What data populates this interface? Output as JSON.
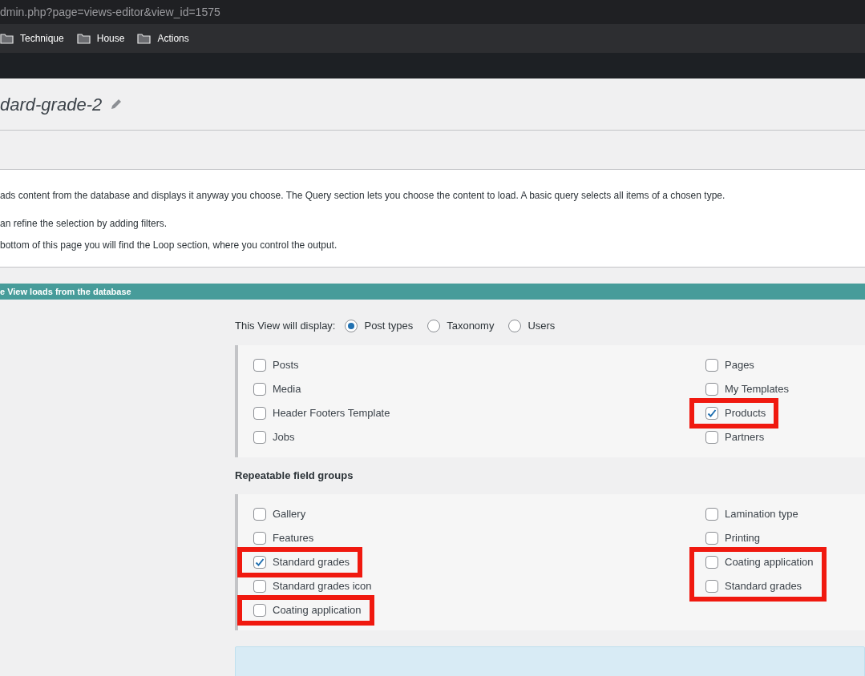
{
  "browser": {
    "url": "dmin.php?page=views-editor&view_id=1575",
    "bookmarks": [
      {
        "label": "Technique"
      },
      {
        "label": "House"
      },
      {
        "label": "Actions"
      }
    ]
  },
  "page_title": "dard-grade-2",
  "intro": [
    "ads content from the database and displays it anyway you choose. The Query section lets you choose the content to load. A basic query selects all items of a chosen type.",
    "an refine the selection by adding filters.",
    " bottom of this page you will find the Loop section, where you control the output."
  ],
  "section_bar": "e View loads from the database",
  "display": {
    "label": "This View will display:",
    "options": [
      {
        "label": "Post types",
        "selected": true
      },
      {
        "label": "Taxonomy",
        "selected": false
      },
      {
        "label": "Users",
        "selected": false
      }
    ]
  },
  "post_types": {
    "left": [
      {
        "kind": "checkbox",
        "label": "Posts",
        "checked": false
      },
      {
        "kind": "checkbox",
        "label": "Media",
        "checked": false
      },
      {
        "kind": "checkbox",
        "label": "Header Footers Template",
        "checked": false
      },
      {
        "kind": "checkbox",
        "label": "Jobs",
        "checked": false
      }
    ],
    "right": [
      {
        "kind": "checkbox",
        "label": "Pages",
        "checked": false
      },
      {
        "kind": "checkbox",
        "label": "My Templates",
        "checked": false
      },
      {
        "kind": "highlight",
        "items": [
          {
            "label": "Products",
            "checked": true
          }
        ]
      },
      {
        "kind": "checkbox",
        "label": "Partners",
        "checked": false
      }
    ]
  },
  "repeatable": {
    "heading": "Repeatable field groups",
    "left": [
      {
        "kind": "checkbox",
        "label": "Gallery",
        "checked": false
      },
      {
        "kind": "checkbox",
        "label": "Features",
        "checked": false
      },
      {
        "kind": "highlight",
        "items": [
          {
            "label": "Standard grades",
            "checked": true
          }
        ]
      },
      {
        "kind": "checkbox",
        "label": "Standard grades icon",
        "checked": false
      },
      {
        "kind": "highlight",
        "items": [
          {
            "label": "Coating application",
            "checked": false
          }
        ]
      }
    ],
    "right": [
      {
        "kind": "checkbox",
        "label": "Lamination type",
        "checked": false
      },
      {
        "kind": "checkbox",
        "label": "Printing",
        "checked": false
      },
      {
        "kind": "highlight",
        "items": [
          {
            "label": "Coating application",
            "checked": false
          },
          {
            "label": "Standard grades",
            "checked": false
          }
        ]
      }
    ]
  }
}
